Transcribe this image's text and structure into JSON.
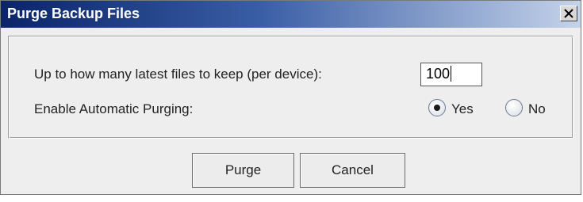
{
  "dialog": {
    "title": "Purge Backup Files",
    "close_glyph": "✕"
  },
  "form": {
    "keep_label": "Up to how many latest files to keep (per device):",
    "keep_value": "100",
    "auto_label": "Enable Automatic Purging:",
    "options": [
      {
        "label": "Yes",
        "selected": true
      },
      {
        "label": "No",
        "selected": false
      }
    ]
  },
  "buttons": {
    "purge_label": "Purge",
    "cancel_label": "Cancel"
  }
}
